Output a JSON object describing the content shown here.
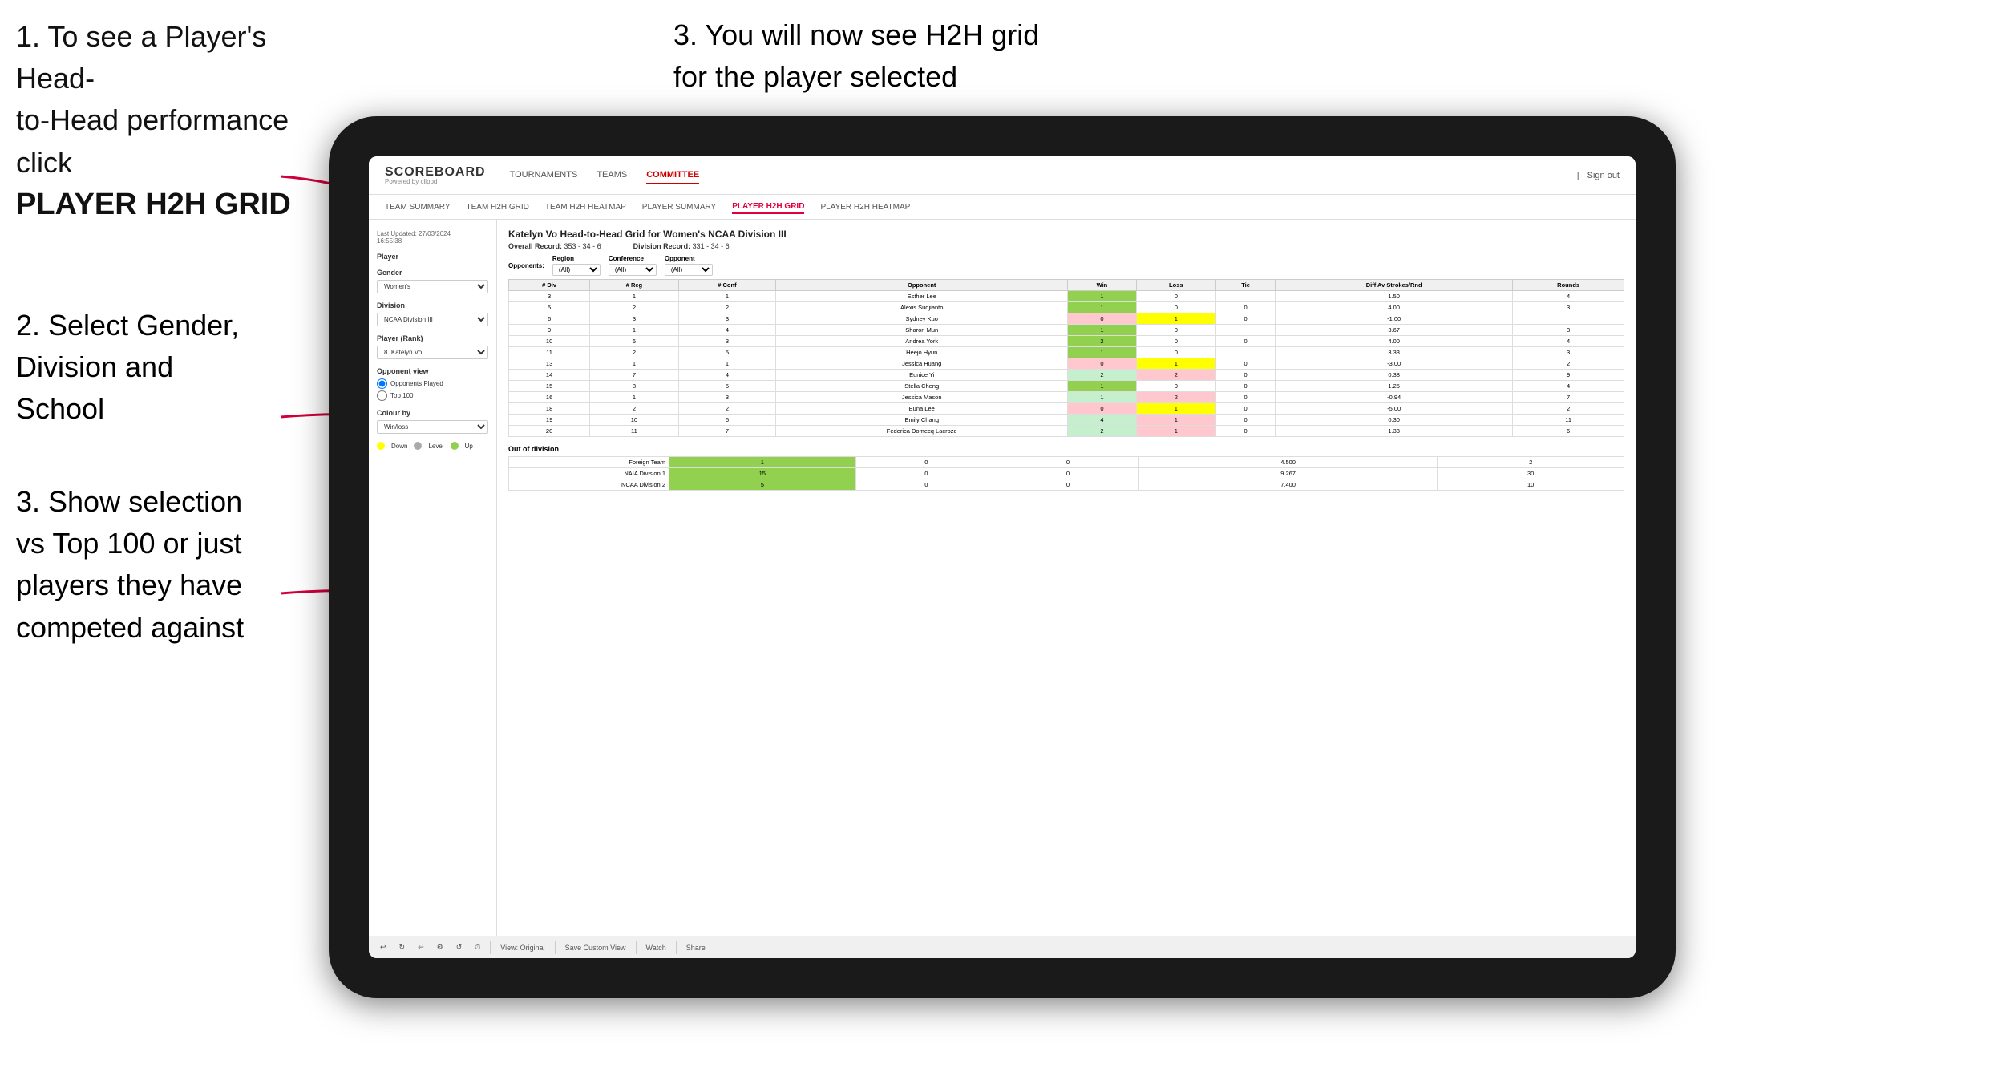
{
  "instructions": {
    "step1_line1": "1. To see a Player's Head-",
    "step1_line2": "to-Head performance click",
    "step1_bold": "PLAYER H2H GRID",
    "step2_line1": "2. Select Gender,",
    "step2_line2": "Division and",
    "step2_line3": "School",
    "step3_top_line1": "3. You will now see H2H grid",
    "step3_top_line2": "for the player selected",
    "step3_bottom_line1": "3. Show selection",
    "step3_bottom_line2": "vs Top 100 or just",
    "step3_bottom_line3": "players they have",
    "step3_bottom_line4": "competed against"
  },
  "nav": {
    "logo": "SCOREBOARD",
    "logo_sub": "Powered by clippd",
    "items": [
      "TOURNAMENTS",
      "TEAMS",
      "COMMITTEE"
    ],
    "sign_in": "Sign out",
    "divider": "|"
  },
  "sub_nav": {
    "items": [
      "TEAM SUMMARY",
      "TEAM H2H GRID",
      "TEAM H2H HEATMAP",
      "PLAYER SUMMARY",
      "PLAYER H2H GRID",
      "PLAYER H2H HEATMAP"
    ]
  },
  "left_panel": {
    "timestamp": "Last Updated: 27/03/2024",
    "timestamp2": "16:55:38",
    "player_label": "Player",
    "gender_label": "Gender",
    "gender_value": "Women's",
    "division_label": "Division",
    "division_value": "NCAA Division III",
    "player_rank_label": "Player (Rank)",
    "player_rank_value": "8. Katelyn Vo",
    "opponent_view_label": "Opponent view",
    "radio1": "Opponents Played",
    "radio2": "Top 100",
    "colour_by_label": "Colour by",
    "colour_by_value": "Win/loss",
    "legend": {
      "down_label": "Down",
      "level_label": "Level",
      "up_label": "Up"
    }
  },
  "grid": {
    "title": "Katelyn Vo Head-to-Head Grid for Women's NCAA Division III",
    "overall_record_label": "Overall Record:",
    "overall_record_value": "353 - 34 - 6",
    "division_record_label": "Division Record:",
    "division_record_value": "331 - 34 - 6",
    "filters": {
      "opponents_label": "Opponents:",
      "region_label": "Region",
      "region_value": "(All)",
      "conference_label": "Conference",
      "conference_value": "(All)",
      "opponent_label": "Opponent",
      "opponent_value": "(All)"
    },
    "col_headers": [
      "# Div",
      "# Reg",
      "# Conf",
      "Opponent",
      "Win",
      "Loss",
      "Tie",
      "Diff Av Strokes/Rnd",
      "Rounds"
    ],
    "rows": [
      {
        "div": "3",
        "reg": "1",
        "conf": "1",
        "opponent": "Esther Lee",
        "win": "1",
        "loss": "0",
        "tie": "",
        "diff": "1.50",
        "rounds": "4",
        "win_color": "green",
        "loss_color": "",
        "tie_color": ""
      },
      {
        "div": "5",
        "reg": "2",
        "conf": "2",
        "opponent": "Alexis Sudjianto",
        "win": "1",
        "loss": "0",
        "tie": "0",
        "diff": "4.00",
        "rounds": "3",
        "win_color": "green",
        "loss_color": "",
        "tie_color": ""
      },
      {
        "div": "6",
        "reg": "3",
        "conf": "3",
        "opponent": "Sydney Kuo",
        "win": "0",
        "loss": "1",
        "tie": "0",
        "diff": "-1.00",
        "rounds": "",
        "win_color": "light-red",
        "loss_color": "yellow",
        "tie_color": ""
      },
      {
        "div": "9",
        "reg": "1",
        "conf": "4",
        "opponent": "Sharon Mun",
        "win": "1",
        "loss": "0",
        "tie": "",
        "diff": "3.67",
        "rounds": "3",
        "win_color": "green",
        "loss_color": "",
        "tie_color": ""
      },
      {
        "div": "10",
        "reg": "6",
        "conf": "3",
        "opponent": "Andrea York",
        "win": "2",
        "loss": "0",
        "tie": "0",
        "diff": "4.00",
        "rounds": "4",
        "win_color": "green",
        "loss_color": "",
        "tie_color": ""
      },
      {
        "div": "11",
        "reg": "2",
        "conf": "5",
        "opponent": "Heejo Hyun",
        "win": "1",
        "loss": "0",
        "tie": "",
        "diff": "3.33",
        "rounds": "3",
        "win_color": "green",
        "loss_color": "",
        "tie_color": ""
      },
      {
        "div": "13",
        "reg": "1",
        "conf": "1",
        "opponent": "Jessica Huang",
        "win": "0",
        "loss": "1",
        "tie": "0",
        "diff": "-3.00",
        "rounds": "2",
        "win_color": "light-red",
        "loss_color": "yellow",
        "tie_color": ""
      },
      {
        "div": "14",
        "reg": "7",
        "conf": "4",
        "opponent": "Eunice Yi",
        "win": "2",
        "loss": "2",
        "tie": "0",
        "diff": "0.38",
        "rounds": "9",
        "win_color": "light-green",
        "loss_color": "light-red",
        "tie_color": ""
      },
      {
        "div": "15",
        "reg": "8",
        "conf": "5",
        "opponent": "Stella Cheng",
        "win": "1",
        "loss": "0",
        "tie": "0",
        "diff": "1.25",
        "rounds": "4",
        "win_color": "green",
        "loss_color": "",
        "tie_color": ""
      },
      {
        "div": "16",
        "reg": "1",
        "conf": "3",
        "opponent": "Jessica Mason",
        "win": "1",
        "loss": "2",
        "tie": "0",
        "diff": "-0.94",
        "rounds": "7",
        "win_color": "light-green",
        "loss_color": "light-red",
        "tie_color": ""
      },
      {
        "div": "18",
        "reg": "2",
        "conf": "2",
        "opponent": "Euna Lee",
        "win": "0",
        "loss": "1",
        "tie": "0",
        "diff": "-5.00",
        "rounds": "2",
        "win_color": "light-red",
        "loss_color": "yellow",
        "tie_color": ""
      },
      {
        "div": "19",
        "reg": "10",
        "conf": "6",
        "opponent": "Emily Chang",
        "win": "4",
        "loss": "1",
        "tie": "0",
        "diff": "0.30",
        "rounds": "11",
        "win_color": "light-green",
        "loss_color": "light-red",
        "tie_color": ""
      },
      {
        "div": "20",
        "reg": "11",
        "conf": "7",
        "opponent": "Federica Domecq Lacroze",
        "win": "2",
        "loss": "1",
        "tie": "0",
        "diff": "1.33",
        "rounds": "6",
        "win_color": "light-green",
        "loss_color": "light-red",
        "tie_color": ""
      }
    ],
    "out_of_division_label": "Out of division",
    "out_of_division_rows": [
      {
        "team": "Foreign Team",
        "win": "1",
        "loss": "0",
        "tie": "0",
        "diff": "4.500",
        "rounds": "2",
        "win_color": "green"
      },
      {
        "team": "NAIA Division 1",
        "win": "15",
        "loss": "0",
        "tie": "0",
        "diff": "9.267",
        "rounds": "30",
        "win_color": "green"
      },
      {
        "team": "NCAA Division 2",
        "win": "5",
        "loss": "0",
        "tie": "0",
        "diff": "7.400",
        "rounds": "10",
        "win_color": "green"
      }
    ]
  },
  "toolbar": {
    "undo": "↩",
    "redo": "↪",
    "view_original": "View: Original",
    "save_custom": "Save Custom View",
    "watch": "Watch",
    "share": "Share"
  }
}
